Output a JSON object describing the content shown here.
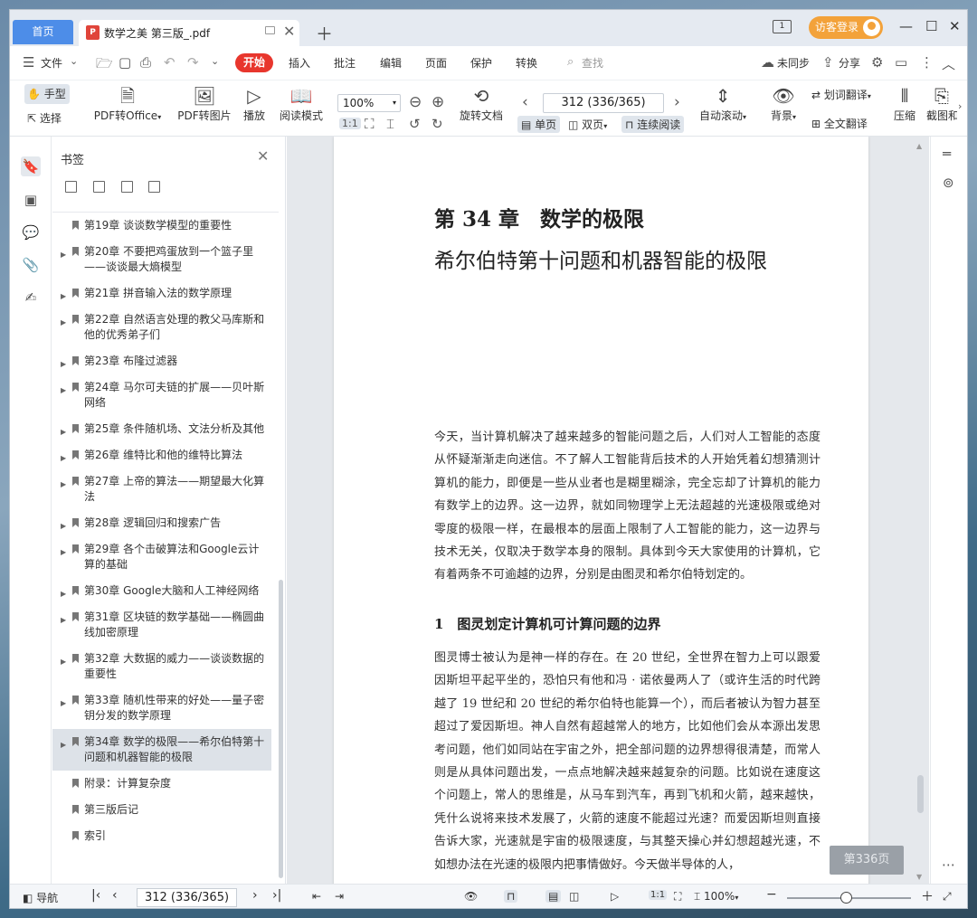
{
  "tabs": {
    "home": "首页",
    "document": "数学之美 第三版_.pdf"
  },
  "titlebar": {
    "login": "访客登录"
  },
  "menu": {
    "file": "文件",
    "start": "开始",
    "insert": "插入",
    "annotate": "批注",
    "edit": "编辑",
    "page": "页面",
    "protect": "保护",
    "convert": "转换",
    "search": "查找",
    "sync": "未同步",
    "share": "分享"
  },
  "ribbon": {
    "hand": "手型",
    "select": "选择",
    "pdf_to_office": "PDF转Office",
    "pdf_to_image": "PDF转图片",
    "play": "播放",
    "read_mode": "阅读模式",
    "zoom": "100%",
    "page_num": "312 (336/365)",
    "rotate": "旋转文档",
    "single": "单页",
    "double": "双页",
    "continuous": "连续阅读",
    "auto_scroll": "自动滚动",
    "background": "背景",
    "word_translate": "划词翻译",
    "full_translate": "全文翻译",
    "compress": "压缩",
    "screenshot": "截图和"
  },
  "sidebar": {
    "title": "书签",
    "bookmarks": [
      {
        "label": "第19章 谈谈数学模型的重要性",
        "arrow": ""
      },
      {
        "label": "第20章 不要把鸡蛋放到一个篮子里——谈谈最大熵模型",
        "arrow": "▶"
      },
      {
        "label": "第21章 拼音输入法的数学原理",
        "arrow": "▶"
      },
      {
        "label": "第22章 自然语言处理的教父马库斯和他的优秀弟子们",
        "arrow": "▶"
      },
      {
        "label": "第23章 布隆过滤器",
        "arrow": "▶"
      },
      {
        "label": "第24章 马尔可夫链的扩展——贝叶斯网络",
        "arrow": "▶"
      },
      {
        "label": "第25章 条件随机场、文法分析及其他",
        "arrow": "▶"
      },
      {
        "label": "第26章 维特比和他的维特比算法",
        "arrow": "▶"
      },
      {
        "label": "第27章 上帝的算法——期望最大化算法",
        "arrow": "▶"
      },
      {
        "label": "第28章 逻辑回归和搜索广告",
        "arrow": "▶"
      },
      {
        "label": "第29章 各个击破算法和Google云计算的基础",
        "arrow": "▶"
      },
      {
        "label": "第30章 Google大脑和人工神经网络",
        "arrow": "▶"
      },
      {
        "label": "第31章 区块链的数学基础——椭圆曲线加密原理",
        "arrow": "▶"
      },
      {
        "label": "第32章 大数据的威力——谈谈数据的重要性",
        "arrow": "▶"
      },
      {
        "label": "第33章 随机性带来的好处——量子密钥分发的数学原理",
        "arrow": "▶"
      },
      {
        "label": "第34章 数学的极限——希尔伯特第十问题和机器智能的极限",
        "arrow": "▶",
        "active": true
      },
      {
        "label": "附录：计算复杂度",
        "arrow": ""
      },
      {
        "label": "第三版后记",
        "arrow": ""
      },
      {
        "label": "索引",
        "arrow": ""
      }
    ]
  },
  "page": {
    "chapter_title": "第 34 章　数学的极限",
    "chapter_subtitle": "希尔伯特第十问题和机器智能的极限",
    "para1": "今天，当计算机解决了越来越多的智能问题之后，人们对人工智能的态度从怀疑渐渐走向迷信。不了解人工智能背后技术的人开始凭着幻想猜测计算机的能力，即便是一些从业者也是糊里糊涂，完全忘却了计算机的能力有数学上的边界。这一边界，就如同物理学上无法超越的光速极限或绝对零度的极限一样，在最根本的层面上限制了人工智能的能力，这一边界与技术无关，仅取决于数学本身的限制。具体到今天大家使用的计算机，它有着两条不可逾越的边界，分别是由图灵和希尔伯特划定的。",
    "section_title": "1　图灵划定计算机可计算问题的边界",
    "para2": "图灵博士被认为是神一样的存在。在 20 世纪，全世界在智力上可以跟爱因斯坦平起平坐的，恐怕只有他和冯 · 诺依曼两人了（或许生活的时代跨越了 19 世纪和 20 世纪的希尔伯特也能算一个），而后者被认为智力甚至超过了爱因斯坦。神人自然有超越常人的地方，比如他们会从本源出发思考问题，他们如同站在宇宙之外，把全部问题的边界想得很清楚，而常人则是从具体问题出发，一点点地解决越来越复杂的问题。比如说在速度这个问题上，常人的思维是，从马车到汽车，再到飞机和火箭，越来越快，凭什么说将来技术发展了，火箭的速度不能超过光速？而爱因斯坦则直接告诉大家，光速就是宇宙的极限速度，与其整天操心并幻想超越光速，不如想办法在光速的极限内把事情做好。今天做半导体的人，",
    "page_label": "第336页"
  },
  "statusbar": {
    "nav": "导航",
    "page_num": "312 (336/365)",
    "zoom": "100%"
  }
}
